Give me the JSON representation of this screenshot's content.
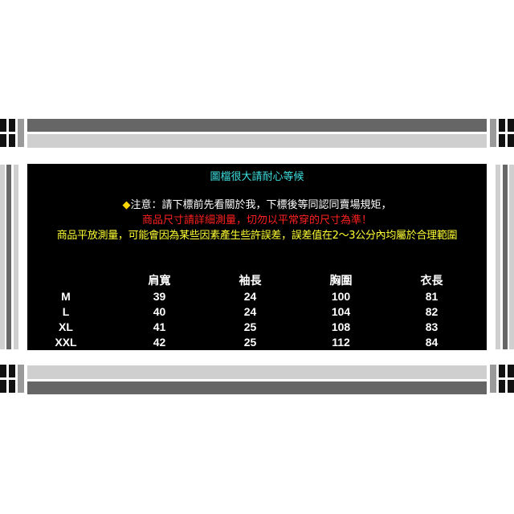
{
  "header": {
    "title": "圖檔很大請耐心等候"
  },
  "notice": {
    "marker": "◆",
    "line1": "注意：請下標前先看關於我，下標後等同認同賣場規矩，",
    "line2": "商品尺寸請詳細測量，切勿以平常穿的尺寸為準！",
    "line3": "商品平放測量，可能會因為某些因素產生些許誤差，誤差值在2～3公分內均屬於合理範圍"
  },
  "colors": {
    "title": "#3fe0e0",
    "marker": "#ffd700",
    "warning": "#ff2020",
    "note": "#ffff33",
    "panel": "#000000",
    "frame_dark": "#666666",
    "frame_light": "#cfcfcf"
  },
  "size_table": {
    "columns": [
      "",
      "肩寬",
      "袖長",
      "胸圍",
      "衣長"
    ],
    "rows": [
      {
        "size": "M",
        "values": [
          "39",
          "24",
          "100",
          "81"
        ]
      },
      {
        "size": "L",
        "values": [
          "40",
          "24",
          "104",
          "82"
        ]
      },
      {
        "size": "XL",
        "values": [
          "41",
          "25",
          "108",
          "83"
        ]
      },
      {
        "size": "XXL",
        "values": [
          "42",
          "25",
          "112",
          "84"
        ]
      }
    ]
  }
}
